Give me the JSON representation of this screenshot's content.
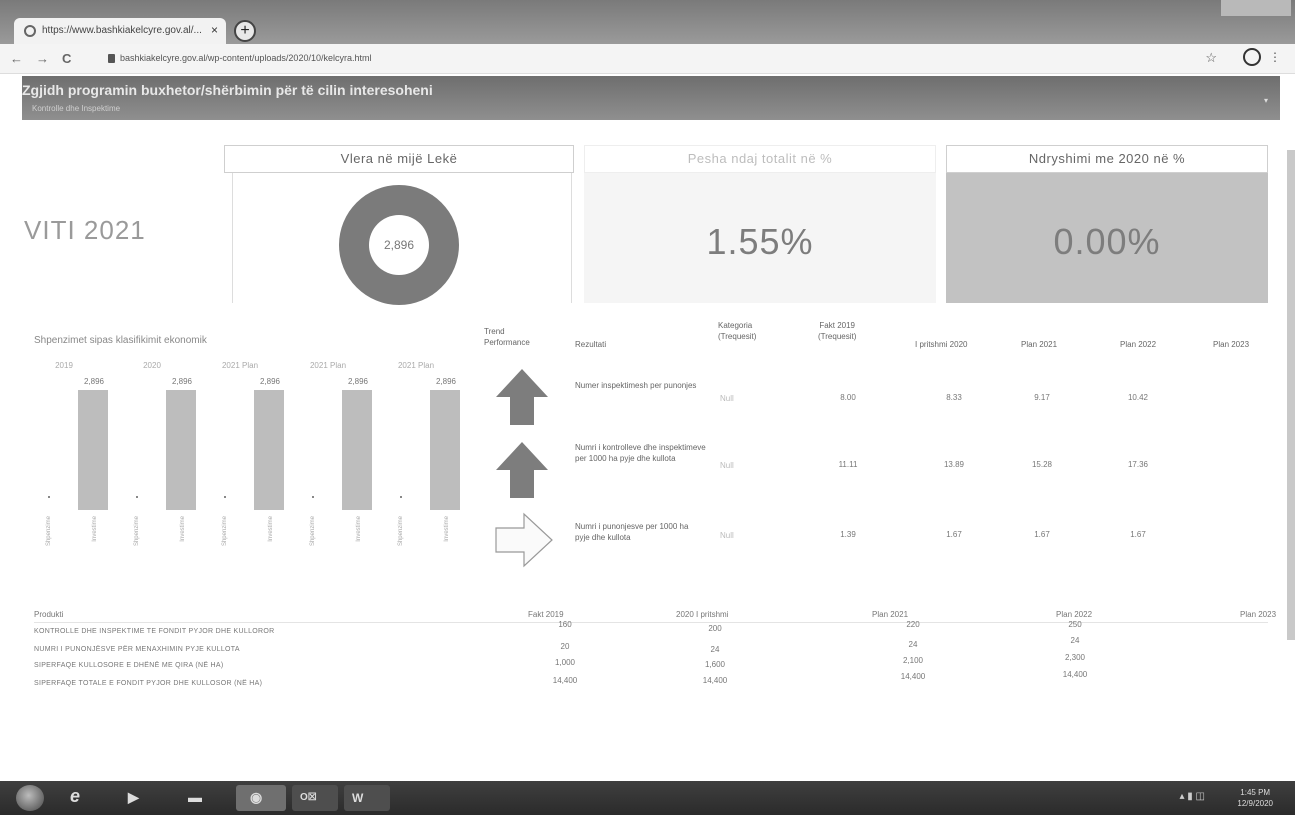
{
  "browser": {
    "tab_title": "https://www.bashkiakelcyre.gov.al/...",
    "close_glyph": "×",
    "newtab_glyph": "+",
    "url": "bashkiakelcyre.gov.al/wp-content/uploads/2020/10/kelcyra.html",
    "back_glyph": "←",
    "forward_glyph": "→",
    "reload_glyph": "C",
    "bookmark_glyph": "☆",
    "menu_glyph": "⋮"
  },
  "page": {
    "header_title": "Zgjidh programin buxhetor/shërbimin për të cilin interesoheni",
    "header_sub": "Kontrolle dhe Inspektime",
    "chevron_glyph": "▾"
  },
  "kpis": {
    "year_label": "VITI 2021",
    "col1_header": "Vlera në mijë Lekë",
    "col2_header": "Pesha ndaj totalit në %",
    "col3_header": "Ndryshimi me 2020 në %",
    "donut_value": "2,896",
    "weight_value": "1.55%",
    "change_value": "0.00%"
  },
  "chart_data": {
    "type": "bar",
    "title": "Shpenzimet sipas klasifikimit ekonomik",
    "groups": [
      "2019",
      "2020",
      "2021 Plan",
      "2021 Plan",
      "2021 Plan"
    ],
    "group_value_labels": [
      "2,896",
      "2,896",
      "2,896",
      "2,896",
      "2,896"
    ],
    "values": [
      2896,
      2896,
      2896,
      2896,
      2896
    ],
    "bar_rotated_labels": [
      "Investime",
      "Investime",
      "Investime",
      "Investime",
      "Investime"
    ],
    "stub_rotated_labels": [
      "Shpenzime",
      "Shpenzime",
      "Shpenzime",
      "Shpenzime",
      "Shpenzime"
    ],
    "bar_color": "#bdbdbd"
  },
  "performance": {
    "headers": {
      "trend": "Trend\nPerformance",
      "rezultati": "Rezultati",
      "kategoria": "Kategoria\n(Trequesit)",
      "fakt2019": "Fakt 2019\n(Trequesit)",
      "pritshmi2020": "I pritshmi 2020",
      "plan2021": "Plan 2021",
      "plan2022": "Plan 2022",
      "plan2023": "Plan 2023"
    },
    "rows": [
      {
        "trend_icon": "arrow-up-icon",
        "rezultati": "Numer inspektimesh per punonjes",
        "kategoria": "Null",
        "fakt2019": "8.00",
        "pritshmi2020": "8.33",
        "plan2021": "9.17",
        "plan2022": "10.42",
        "plan2023": ""
      },
      {
        "trend_icon": "arrow-up-icon",
        "rezultati": "Numri i kontrolleve dhe inspektimeve per 1000 ha pyje dhe kullota",
        "kategoria": "Null",
        "fakt2019": "11.11",
        "pritshmi2020": "13.89",
        "plan2021": "15.28",
        "plan2022": "17.36",
        "plan2023": ""
      },
      {
        "trend_icon": "arrow-right-icon",
        "rezultati": "Numri i punonjesve per 1000 ha pyje dhe kullota",
        "kategoria": "Null",
        "fakt2019": "1.39",
        "pritshmi2020": "1.67",
        "plan2021": "1.67",
        "plan2022": "1.67",
        "plan2023": ""
      }
    ]
  },
  "products": {
    "headers": {
      "produkti": "Produkti",
      "fakt2019": "Fakt 2019",
      "pritshmi2020": "2020 I pritshmi",
      "plan2021": "Plan 2021",
      "plan2022": "Plan 2022",
      "plan2023": "Plan 2023"
    },
    "rows": [
      {
        "label": "KONTROLLE DHE INSPEKTIME TE FONDIT PYJOR DHE KULLOROR",
        "fakt2019": "160",
        "pritshmi2020": "200",
        "plan2021": "220",
        "plan2022": "250"
      },
      {
        "label": "NUMRI I PUNONJËSVE PËR MENAXHIMIN PYJE KULLOTA",
        "fakt2019": "20",
        "pritshmi2020": "24",
        "plan2021": "24",
        "plan2022": "24"
      },
      {
        "label": "SIPERFAQE KULLOSORE E DHËNË ME QIRA (NË HA)",
        "fakt2019": "1,000",
        "pritshmi2020": "1,600",
        "plan2021": "2,100",
        "plan2022": "2,300"
      },
      {
        "label": "SIPERFAQE TOTALE E FONDIT PYJOR DHE KULLOSOR (NË HA)",
        "fakt2019": "14,400",
        "pritshmi2020": "14,400",
        "plan2021": "14,400",
        "plan2022": "14,400"
      }
    ]
  },
  "taskbar": {
    "outlook_label": "O☒",
    "word_label": "W",
    "clock_time": "1:45 PM",
    "clock_date": "12/9/2020"
  }
}
